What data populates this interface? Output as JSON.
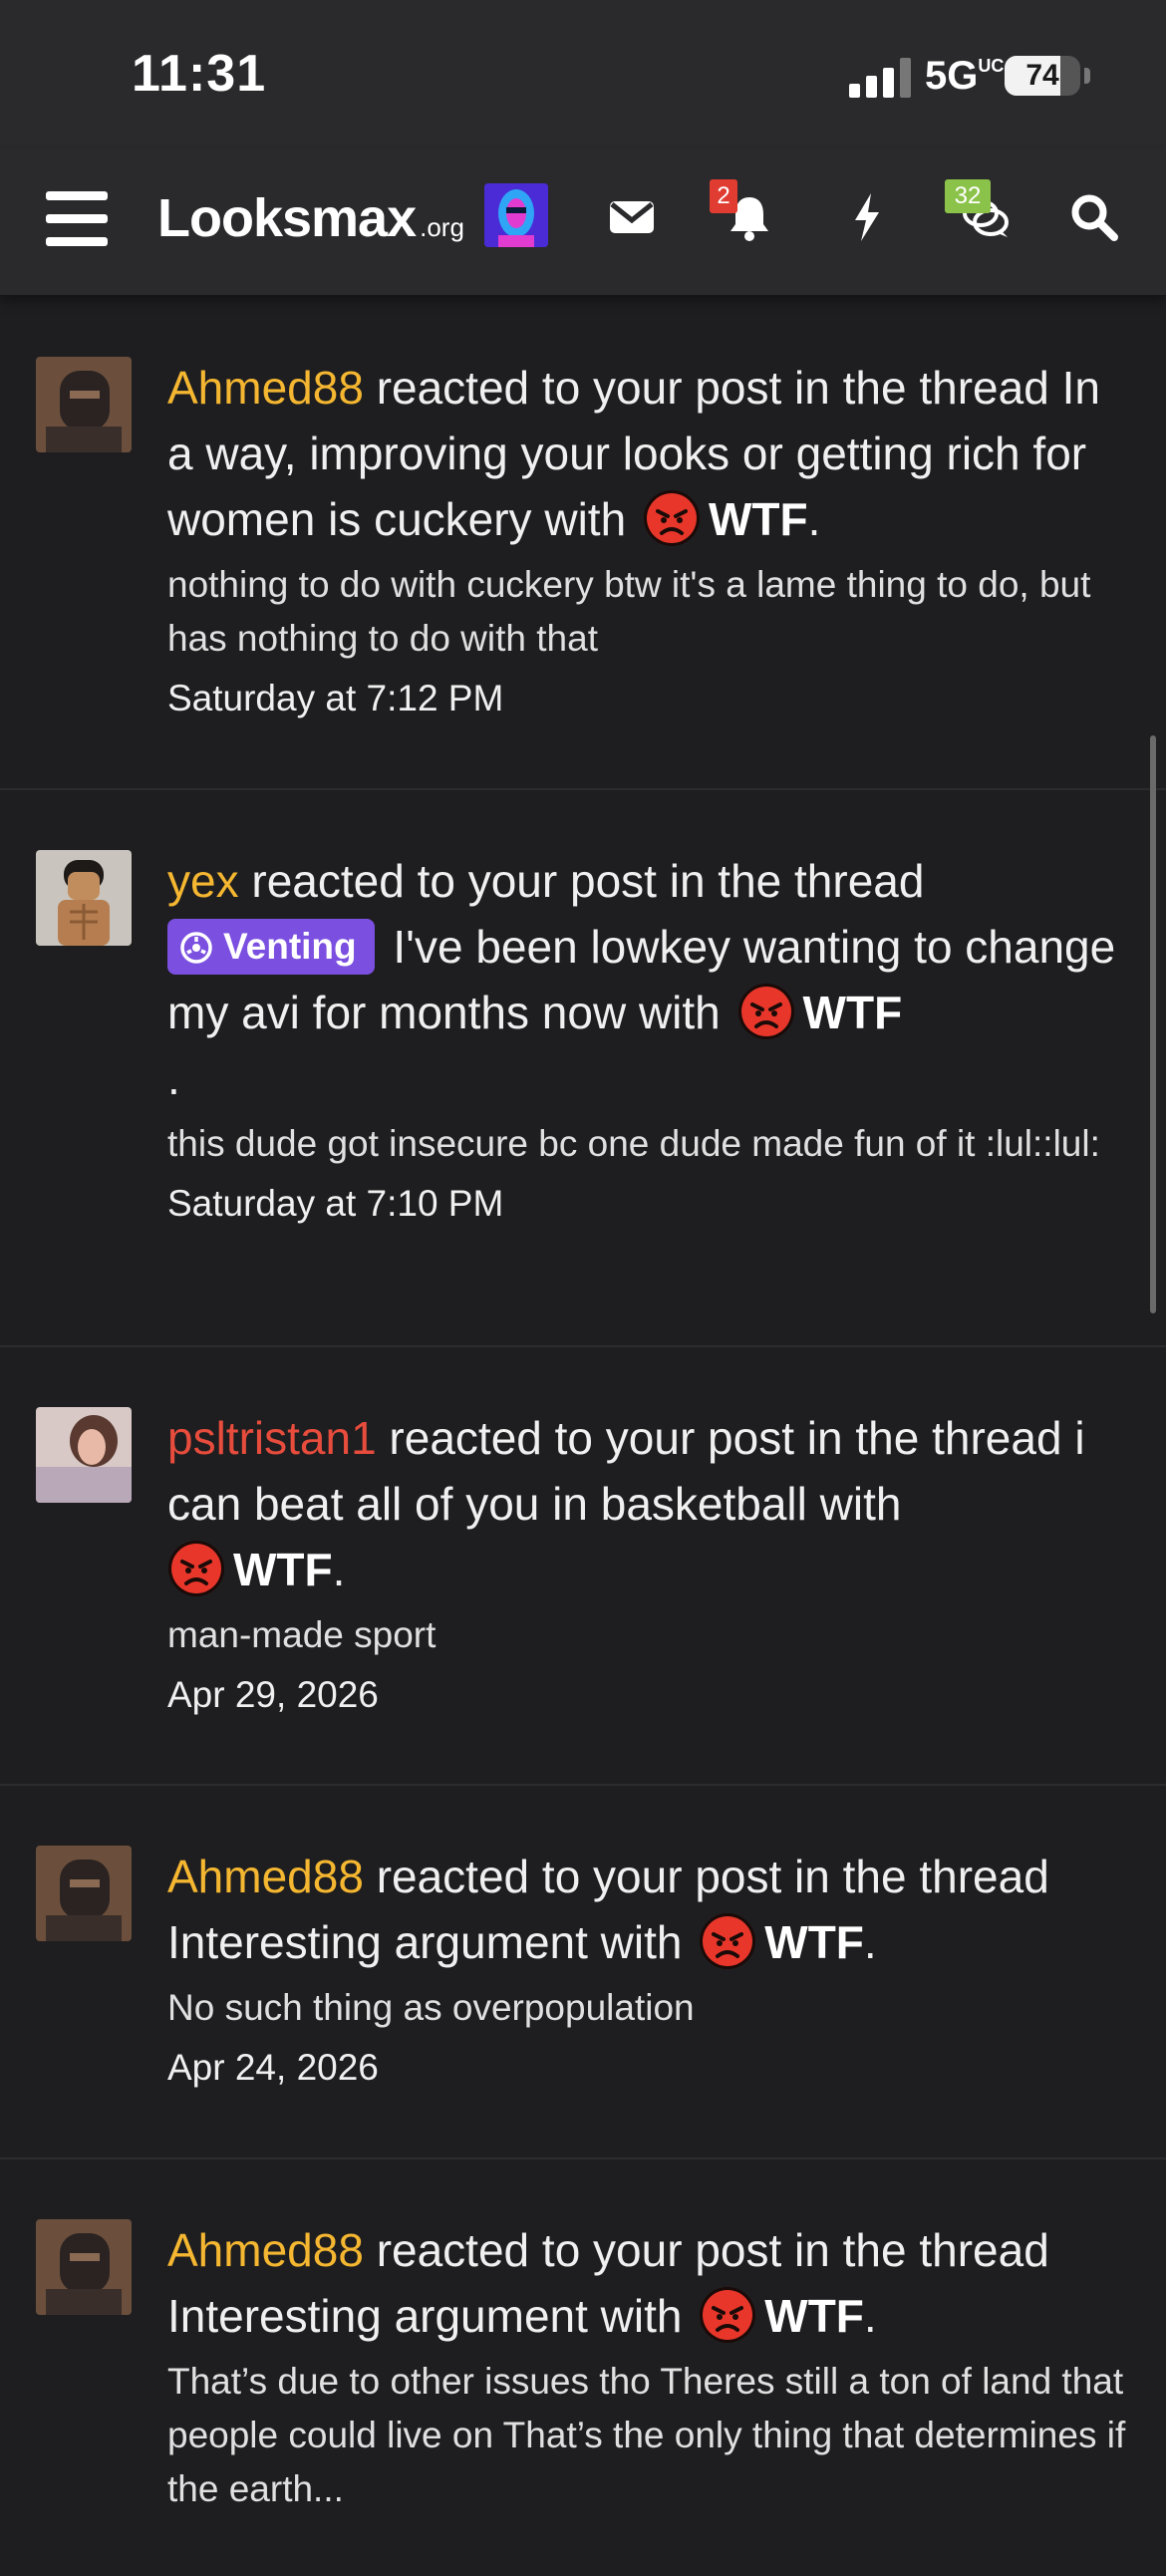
{
  "status_bar": {
    "time": "11:31",
    "network": "5G",
    "network_sup": "UC",
    "battery": "74",
    "battery_level": 0.74
  },
  "navbar": {
    "logo": "Looksmax",
    "logo_tld": ".org",
    "alerts_badge": "2",
    "conversations_badge": "32",
    "accent_badge_red": "#e03c31",
    "accent_badge_green": "#8bc34a"
  },
  "alerts": [
    {
      "user": "Ahmed88",
      "action": " reacted to your post in the thread ",
      "thread": "In a way, improving your looks or getting rich for women is cuckery",
      "with": " with ",
      "reaction": "WTF",
      "end": ".",
      "snippet": "nothing to do with cuckery btw it's a lame thing to do, but has nothing to do with that",
      "time": "Saturday at 7:12 PM"
    },
    {
      "user": "yex",
      "action": " reacted to your post in the thread",
      "prefix": "Venting",
      "thread": " I've been lowkey wanting to change my avi for months now",
      "with": " with ",
      "reaction": "WTF",
      "end": ".",
      "snippet": "this dude got insecure bc one dude made fun of it :lul::lul:",
      "time": "Saturday at 7:10 PM"
    },
    {
      "user": "psltristan1",
      "action": " reacted to your post in the thread ",
      "thread": "i can beat all of you in basketball",
      "with": " with ",
      "reaction": "WTF",
      "end": ".",
      "snippet": "man-made sport",
      "time": "Apr 29, 2026"
    },
    {
      "user": "Ahmed88",
      "action": " reacted to your post in the thread ",
      "thread": "Interesting argument",
      "with": " with ",
      "reaction": "WTF",
      "end": ".",
      "snippet": "No such thing as overpopulation",
      "time": "Apr 24, 2026"
    },
    {
      "user": "Ahmed88",
      "action": " reacted to your post in the thread ",
      "thread": "Interesting argument",
      "with": " with ",
      "reaction": "WTF",
      "end": ".",
      "snippet": "That’s due to other issues tho Theres still a ton of land that people could live on That’s the only thing that determines if the earth..."
    }
  ]
}
